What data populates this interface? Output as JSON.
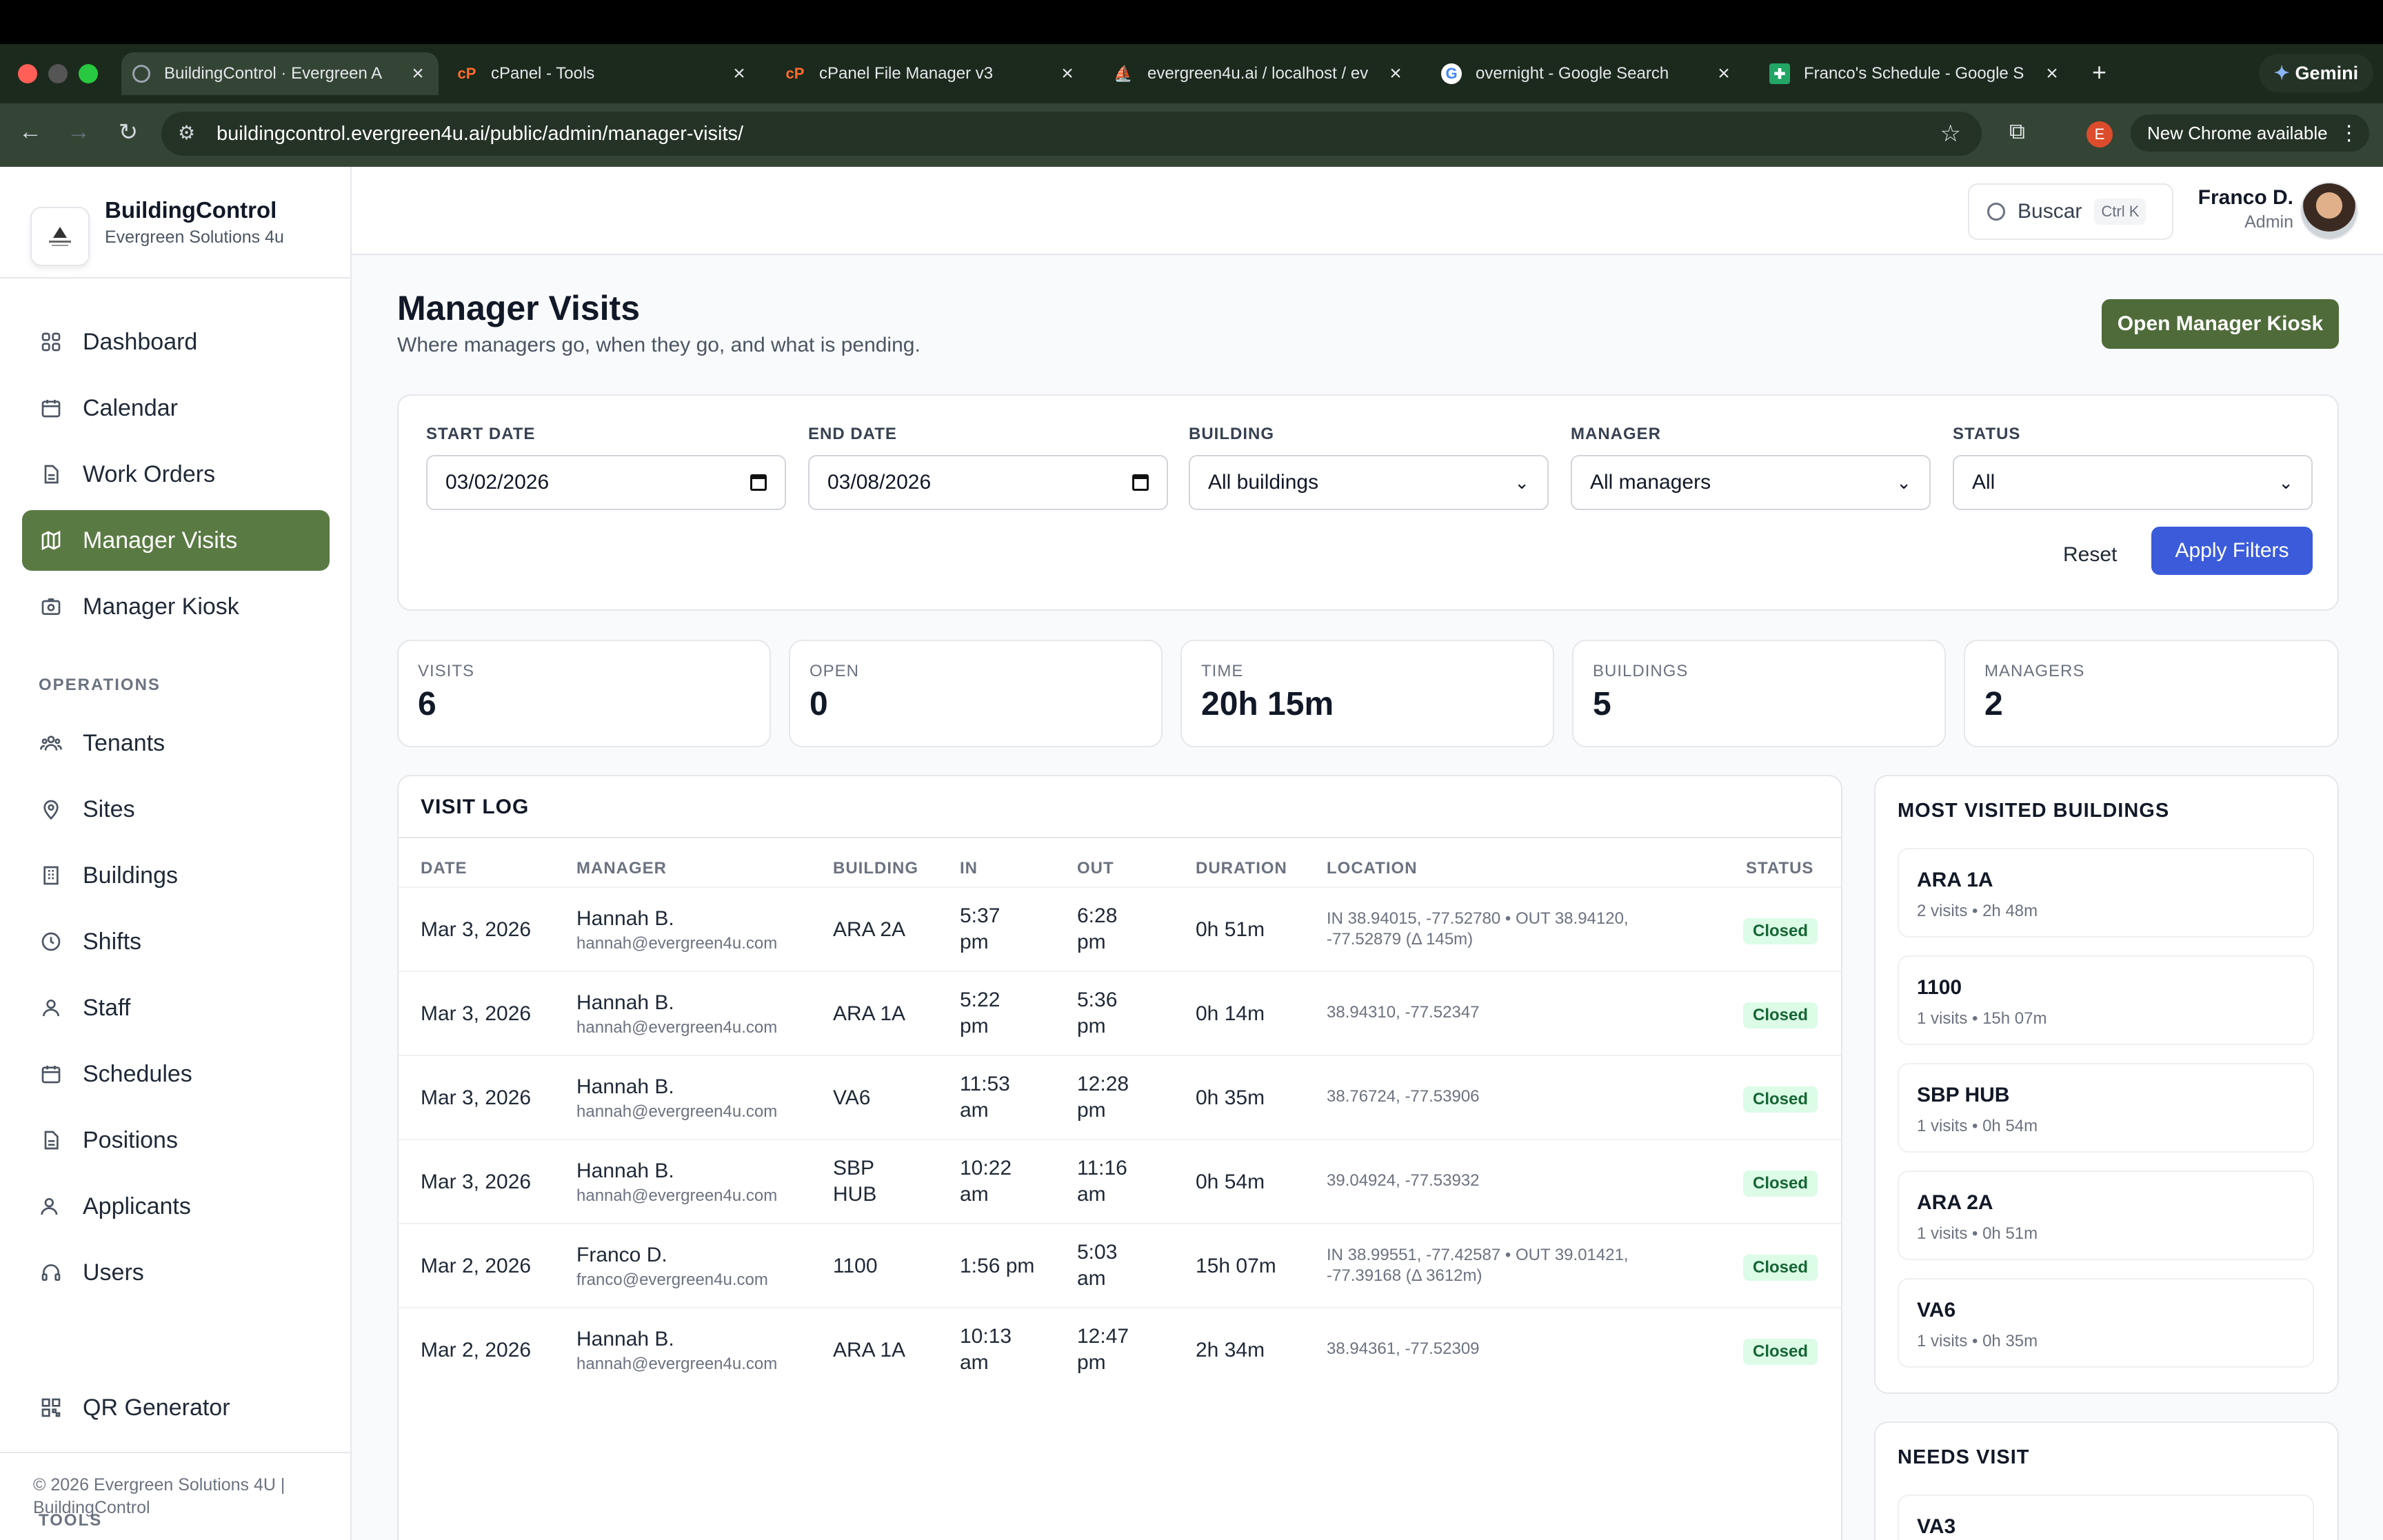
{
  "browser": {
    "tabs": [
      {
        "title": "BuildingControl · Evergreen A",
        "active": true
      },
      {
        "title": "cPanel - Tools"
      },
      {
        "title": "cPanel File Manager v3"
      },
      {
        "title": "evergreen4u.ai / localhost / ev"
      },
      {
        "title": "overnight - Google Search"
      },
      {
        "title": "Franco's Schedule - Google S"
      }
    ],
    "gemini_label": "Gemini",
    "url": "buildingcontrol.evergreen4u.ai/public/admin/manager-visits/",
    "profile_initial": "E",
    "update_label": "New Chrome available"
  },
  "brand": {
    "name": "BuildingControl",
    "subtitle": "Evergreen Solutions 4u"
  },
  "sidebar": {
    "main_items": [
      {
        "label": "Dashboard",
        "icon": "grid-icon"
      },
      {
        "label": "Calendar",
        "icon": "calendar-icon"
      },
      {
        "label": "Work Orders",
        "icon": "document-icon"
      },
      {
        "label": "Manager Visits",
        "icon": "map-icon",
        "active": true
      },
      {
        "label": "Manager Kiosk",
        "icon": "camera-icon"
      }
    ],
    "operations_title": "OPERATIONS",
    "operations_items": [
      {
        "label": "Tenants",
        "icon": "people-icon"
      },
      {
        "label": "Sites",
        "icon": "pin-icon"
      },
      {
        "label": "Buildings",
        "icon": "building-icon"
      },
      {
        "label": "Shifts",
        "icon": "clock-icon"
      },
      {
        "label": "Staff",
        "icon": "user-icon"
      },
      {
        "label": "Schedules",
        "icon": "calendar-icon"
      },
      {
        "label": "Positions",
        "icon": "document-icon"
      },
      {
        "label": "Applicants",
        "icon": "user-plus-icon"
      },
      {
        "label": "Users",
        "icon": "headset-icon"
      }
    ],
    "tools_title": "TOOLS",
    "tools_items": [
      {
        "label": "QR Generator",
        "icon": "qr-icon"
      }
    ],
    "footer": "© 2026 Evergreen Solutions 4U | BuildingControl"
  },
  "topbar": {
    "search_label": "Buscar",
    "search_shortcut": "Ctrl K",
    "user_name": "Franco D.",
    "user_role": "Admin"
  },
  "page": {
    "title": "Manager Visits",
    "subtitle": "Where managers go, when they go, and what is pending.",
    "kiosk_button": "Open Manager Kiosk"
  },
  "filters": {
    "start_label": "START DATE",
    "start_value": "03/02/2026",
    "end_label": "END DATE",
    "end_value": "03/08/2026",
    "building_label": "BUILDING",
    "building_value": "All buildings",
    "manager_label": "MANAGER",
    "manager_value": "All managers",
    "status_label": "STATUS",
    "status_value": "All",
    "reset_label": "Reset",
    "apply_label": "Apply Filters"
  },
  "stats": [
    {
      "label": "VISITS",
      "value": "6"
    },
    {
      "label": "OPEN",
      "value": "0"
    },
    {
      "label": "TIME",
      "value": "20h 15m"
    },
    {
      "label": "BUILDINGS",
      "value": "5"
    },
    {
      "label": "MANAGERS",
      "value": "2"
    }
  ],
  "visit_log": {
    "title": "VISIT LOG",
    "columns": [
      "DATE",
      "MANAGER",
      "BUILDING",
      "IN",
      "OUT",
      "DURATION",
      "LOCATION",
      "STATUS"
    ],
    "rows": [
      {
        "date": "Mar 3, 2026",
        "manager": "Hannah B.",
        "email": "hannah@evergreen4u.com",
        "building": "ARA 2A",
        "in": "5:37 pm",
        "out": "6:28 pm",
        "duration": "0h 51m",
        "location": "IN 38.94015, -77.52780 • OUT 38.94120, -77.52879 (Δ 145m)",
        "status": "Closed"
      },
      {
        "date": "Mar 3, 2026",
        "manager": "Hannah B.",
        "email": "hannah@evergreen4u.com",
        "building": "ARA 1A",
        "in": "5:22 pm",
        "out": "5:36 pm",
        "duration": "0h 14m",
        "location": "38.94310, -77.52347",
        "status": "Closed"
      },
      {
        "date": "Mar 3, 2026",
        "manager": "Hannah B.",
        "email": "hannah@evergreen4u.com",
        "building": "VA6",
        "in": "11:53 am",
        "out": "12:28 pm",
        "duration": "0h 35m",
        "location": "38.76724, -77.53906",
        "status": "Closed"
      },
      {
        "date": "Mar 3, 2026",
        "manager": "Hannah B.",
        "email": "hannah@evergreen4u.com",
        "building": "SBP HUB",
        "in": "10:22 am",
        "out": "11:16 am",
        "duration": "0h 54m",
        "location": "39.04924, -77.53932",
        "status": "Closed"
      },
      {
        "date": "Mar 2, 2026",
        "manager": "Franco D.",
        "email": "franco@evergreen4u.com",
        "building": "1100",
        "in": "1:56 pm",
        "out": "5:03 am",
        "duration": "15h 07m",
        "location": "IN 38.99551, -77.42587 • OUT 39.01421, -77.39168 (Δ 3612m)",
        "status": "Closed"
      },
      {
        "date": "Mar 2, 2026",
        "manager": "Hannah B.",
        "email": "hannah@evergreen4u.com",
        "building": "ARA 1A",
        "in": "10:13 am",
        "out": "12:47 pm",
        "duration": "2h 34m",
        "location": "38.94361, -77.52309",
        "status": "Closed"
      }
    ]
  },
  "most_visited": {
    "title": "MOST VISITED BUILDINGS",
    "items": [
      {
        "name": "ARA 1A",
        "summary": "2 visits • 2h 48m"
      },
      {
        "name": "1100",
        "summary": "1 visits • 15h 07m"
      },
      {
        "name": "SBP HUB",
        "summary": "1 visits • 0h 54m"
      },
      {
        "name": "ARA 2A",
        "summary": "1 visits • 0h 51m"
      },
      {
        "name": "VA6",
        "summary": "1 visits • 0h 35m"
      }
    ]
  },
  "needs_visit": {
    "title": "NEEDS VISIT",
    "items": [
      {
        "name": "VA3"
      }
    ]
  },
  "colors": {
    "accent_green": "#5a7a43",
    "apply_blue": "#3b5bdb",
    "kiosk_green": "#4f6b3a",
    "closed_bg": "#dcfce7",
    "closed_text": "#166534"
  }
}
